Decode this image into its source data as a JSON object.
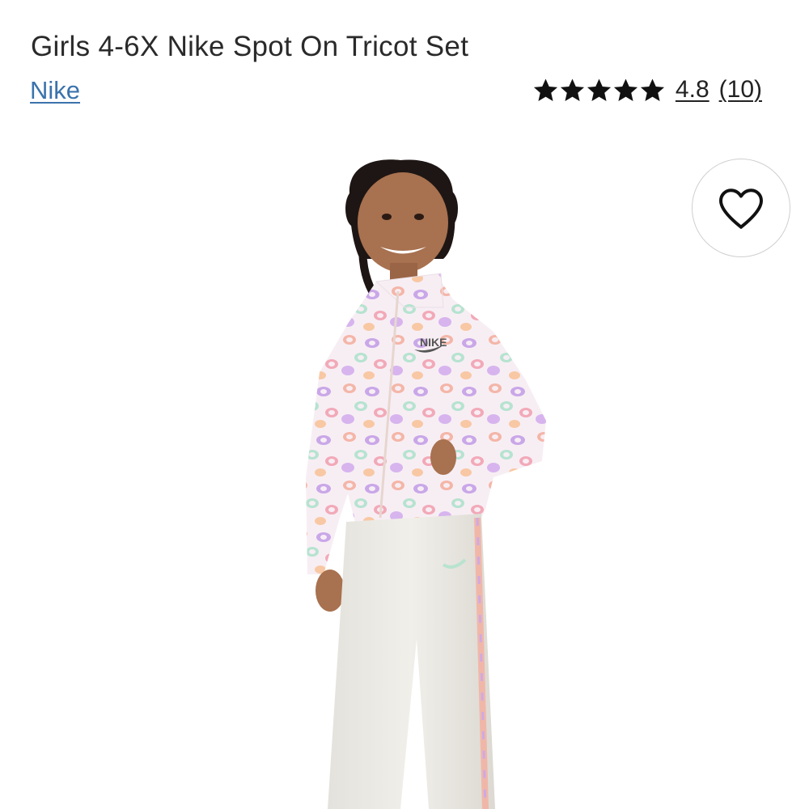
{
  "product": {
    "title": "Girls 4-6X Nike Spot On Tricot Set",
    "brand": "Nike",
    "rating": {
      "value": "4.8",
      "count": "(10)",
      "stars": 5
    }
  },
  "image": {
    "alt_subject": "girl-in-leopard-print-tricot-jacket-and-pants",
    "logo_text": "NIKE"
  },
  "icons": {
    "wishlist": "heart-outline-icon",
    "star": "star-filled-icon"
  },
  "colors": {
    "brand_link": "#3b73ad",
    "text": "#222222",
    "star": "#111111",
    "wishlist_border": "#cfcfcf"
  }
}
